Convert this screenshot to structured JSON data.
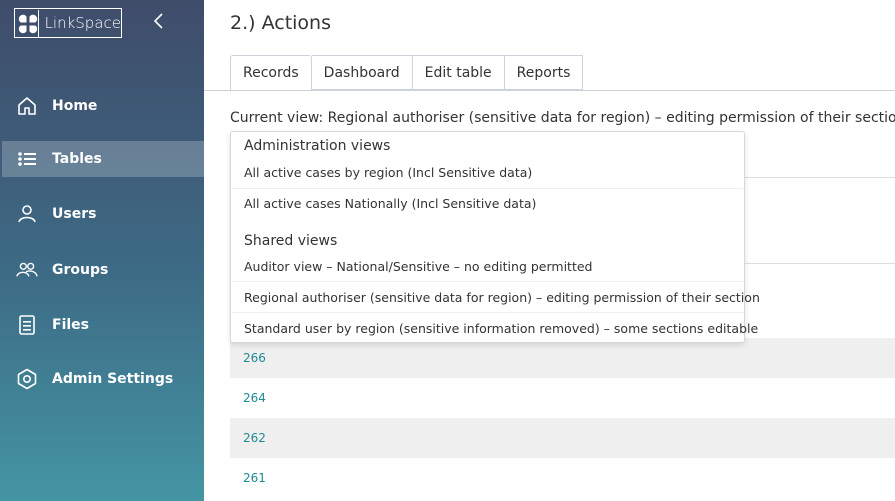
{
  "app": {
    "logo_text": "LinkSpace"
  },
  "sidebar": {
    "items": [
      {
        "label": "Home",
        "icon": "home-icon"
      },
      {
        "label": "Tables",
        "icon": "list-icon",
        "active": true
      },
      {
        "label": "Users",
        "icon": "user-icon"
      },
      {
        "label": "Groups",
        "icon": "groups-icon"
      },
      {
        "label": "Files",
        "icon": "file-icon"
      },
      {
        "label": "Admin Settings",
        "icon": "settings-icon"
      }
    ]
  },
  "main": {
    "title": "2.) Actions",
    "tabs": [
      {
        "label": "Records",
        "active": true
      },
      {
        "label": "Dashboard"
      },
      {
        "label": "Edit table"
      },
      {
        "label": "Reports"
      }
    ],
    "current_view_label": "Current view: Regional authoriser (sensitive data for region) – editing permission of their section",
    "records": [
      "266",
      "264",
      "262",
      "261"
    ]
  },
  "view_dropdown": {
    "admin_header": "Administration views",
    "admin_views": [
      "All active cases by region (Incl Sensitive data)",
      "All active cases Nationally (Incl Sensitive data)"
    ],
    "shared_header": "Shared views",
    "shared_views": [
      "Auditor view – National/Sensitive – no editing permitted",
      "Regional authoriser (sensitive data for region) – editing permission of their section",
      "Standard user by region (sensitive information removed) – some sections editable"
    ]
  },
  "colors": {
    "sidebar_top": "#3f4c6a",
    "sidebar_bottom": "#4495a4",
    "link": "#1f8a94"
  }
}
